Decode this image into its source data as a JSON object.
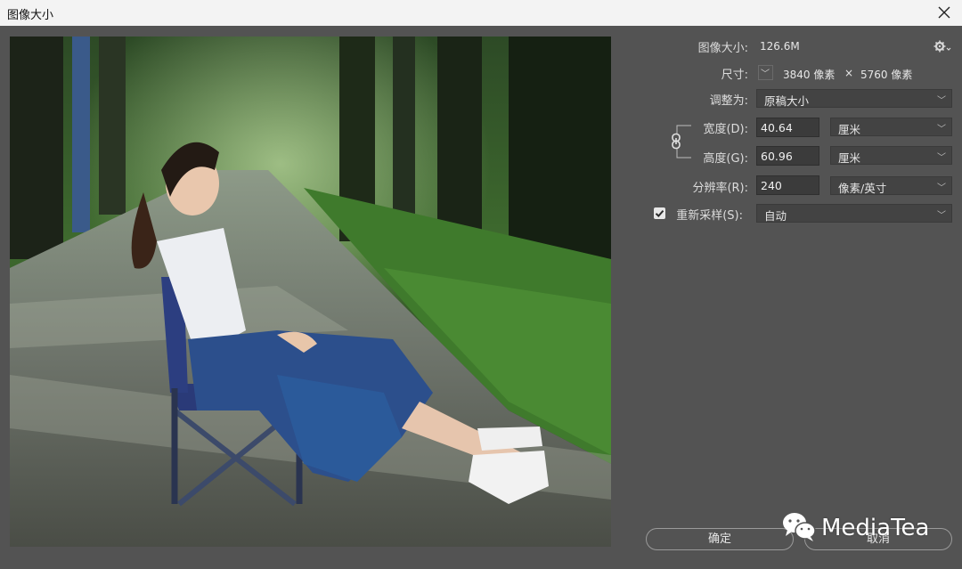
{
  "window": {
    "title": "图像大小"
  },
  "image_size": {
    "label": "图像大小:",
    "value": "126.6M"
  },
  "dimensions": {
    "label": "尺寸:",
    "width": "3840 像素",
    "times": "×",
    "height": "5760 像素"
  },
  "fit_to": {
    "label": "调整为:",
    "value": "原稿大小"
  },
  "width": {
    "label": "宽度(D):",
    "value": "40.64",
    "unit": "厘米"
  },
  "height": {
    "label": "高度(G):",
    "value": "60.96",
    "unit": "厘米"
  },
  "resolution": {
    "label": "分辨率(R):",
    "value": "240",
    "unit": "像素/英寸"
  },
  "resample": {
    "label": "重新采样(S):",
    "value": "自动",
    "checked": true
  },
  "buttons": {
    "ok": "确定",
    "cancel": "取消"
  },
  "watermark": {
    "text": "MediaTea"
  },
  "colors": {
    "panel": "#535353",
    "titlebar": "#f3f3f3",
    "field": "#434343"
  }
}
